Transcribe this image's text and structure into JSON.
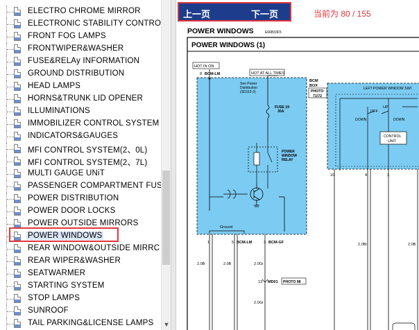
{
  "sidebar": {
    "items": [
      {
        "label": "ELECTRO CHROME MIRROR"
      },
      {
        "label": "ELECTRONIC STABILITY CONTRO"
      },
      {
        "label": "FRONT FOG LAMPS"
      },
      {
        "label": "FRONTWIPER&WASHER"
      },
      {
        "label": "FUSE&RELAy INFORMATION"
      },
      {
        "label": "GROUND DISTRIBUTION"
      },
      {
        "label": "HEAD LAMPS"
      },
      {
        "label": "HORNS&TRUNK LID OPENER"
      },
      {
        "label": "ILLUMINATIONS"
      },
      {
        "label": "IMMOBILIZER CONTROL SYSTEM"
      },
      {
        "label": "INDICATORS&GAUGES"
      },
      {
        "label": "MFI CONTROL SYSTEM(2、0L)"
      },
      {
        "label": "MFI CONTROL SYSTEM(2、7L)"
      },
      {
        "label": "MULTI GAUGE UNiT"
      },
      {
        "label": "PASSENGER COMPARTMENT FUSI"
      },
      {
        "label": "POWER DISTRIBUTION"
      },
      {
        "label": "POWER DOOR LOCKS"
      },
      {
        "label": "POWER OUTSIDE MIRRORS"
      },
      {
        "label": "POWER WINDOWS"
      },
      {
        "label": "REAR WINDOW&OUTSIDE MIRRC"
      },
      {
        "label": "REAR WIPER&WASHER"
      },
      {
        "label": "SEATWARMER"
      },
      {
        "label": "STARTING SYSTEM"
      },
      {
        "label": "STOP LAMPS"
      },
      {
        "label": "SUNROOF"
      },
      {
        "label": "TAIL PARKING&LICENSE LAMPS"
      }
    ],
    "selected_index": 18
  },
  "nav": {
    "prev_label": "上一页",
    "next_label": "下一页",
    "page_info": "当前为 80 / 155"
  },
  "diagram": {
    "page_title": "POWER WINDOWS",
    "page_code": "E66B33F5",
    "section_title": "POWER WINDOWS (1)",
    "hot_in_on": "HOT IN ON",
    "hot_at_all_times": "HOT AT ALL TIMES",
    "bcm_box": "BCM\nBOX",
    "photo_71_72": "PHOTO\n71/72",
    "pin8": "8",
    "bcm_lm_top": "BCM-LM",
    "see_power_1": "See Power",
    "see_power_2": "Distribution",
    "see_power_3": "(SD110-3)",
    "fuse": "FUSE 19",
    "fuse_amp": "30A",
    "relay_1": "POWER",
    "relay_2": "WINDOW",
    "relay_3": "RELAY",
    "ground_label": "Ground",
    "pin1": "1",
    "pin5": "5",
    "bcm_lm_bottom": "BCM-LM",
    "pin3": "3",
    "bcm_gf": "BCM-GF",
    "wire_2_0b_1": "2.0B",
    "wire_2_0b_2": "2.0B",
    "wire_2_0gr_1": "2.0Gr",
    "wire_2_0gr_2": "2.0Gr",
    "wire_2_0br": "2.0Br",
    "wire_2_0b_right": "2.0B",
    "md01_pin": "13",
    "md01": "MD01",
    "photo_98": "PHOTO 98",
    "left_pw_switch": "LEFT POWER WINDOW SWI",
    "off": "OFF",
    "up": "UP",
    "down_1": "DOWN",
    "down_2": "DOWN",
    "control_1": "CONTROL",
    "control_2": "UNIT",
    "pin10": "10",
    "pin4": "4",
    "pin3b": "3"
  },
  "colors": {
    "nav_bg": "#1d3d8c",
    "highlight_red": "#e0363c",
    "diagram_blue": "#7ccbf2"
  }
}
